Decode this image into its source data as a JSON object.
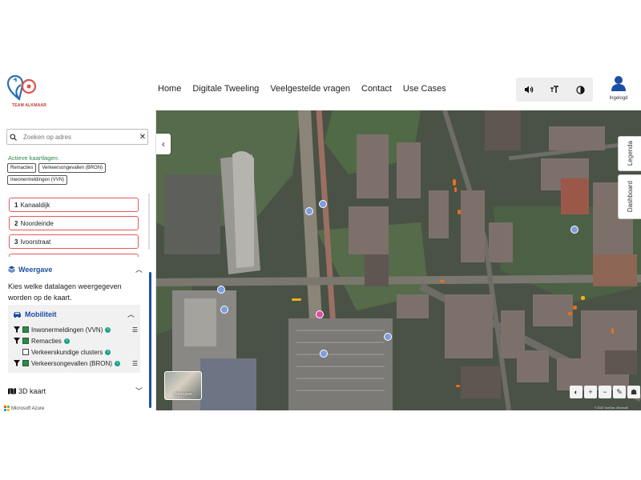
{
  "header": {
    "logo_text": "TEAM ALKMAAR",
    "nav": [
      "Home",
      "Digitale Tweeling",
      "Veelgestelde vragen",
      "Contact",
      "Use Cases"
    ],
    "tools": [
      {
        "name": "speaker-icon",
        "glyph": "🔊"
      },
      {
        "name": "text-size-icon",
        "glyph": "ᴛT"
      },
      {
        "name": "contrast-icon",
        "glyph": "◐"
      }
    ],
    "user_label": "Ingelogd"
  },
  "sidebar": {
    "search_placeholder": "Zoeken op adres",
    "active_title": "Actieve kaartlagen:",
    "active_layers": [
      "Remacties",
      "Verkeersongevallen (BRON)",
      "Inwonermeldingen (VVN)"
    ],
    "results": [
      {
        "num": "1",
        "name": "Kanaaldijk"
      },
      {
        "num": "2",
        "name": "Noordeinde"
      },
      {
        "num": "3",
        "name": "Ivoorstraat"
      }
    ],
    "weergave_title": "Weergave",
    "weergave_desc": "Kies welke datalagen weergegeven worden op de kaart.",
    "mobility_title": "Mobiliteit",
    "layers": [
      {
        "label": "Inwonermeldingen (VVN)",
        "filter": true,
        "checked": true,
        "settings": true
      },
      {
        "label": "Remacties",
        "filter": true,
        "checked": true,
        "settings": false
      },
      {
        "label": "Verkeerskundige clusters",
        "filter": false,
        "checked": false,
        "settings": false
      },
      {
        "label": "Verkeersongevallen (BRON)",
        "filter": true,
        "checked": true,
        "settings": true
      }
    ],
    "kaart3d_title": "3D kaart",
    "footer": "Microsoft Azure"
  },
  "map": {
    "tabs": {
      "legenda": "Legenda",
      "dashboard": "Dashboard"
    },
    "basemap_label": "Weergave",
    "controls": [
      "◐",
      "+",
      "−",
      "✎",
      "☗"
    ],
    "attribution": "© 2023 TomTom, Microsoft",
    "colors": {
      "marker_blue": "#7c9ee0",
      "marker_pink": "#e04aa8",
      "remactie_orange": "#e8701a",
      "remactie_yellow": "#e8b41a",
      "accent": "#1c4ea3"
    }
  }
}
